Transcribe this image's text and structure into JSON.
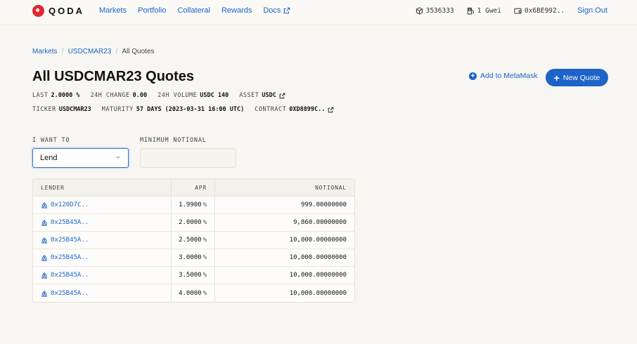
{
  "brand": {
    "name": "QODA"
  },
  "nav": {
    "links": [
      "Markets",
      "Portfolio",
      "Collateral",
      "Rewards",
      "Docs"
    ],
    "block": "3536333",
    "gas": "1 Gwei",
    "wallet": "0x6BE992..",
    "sign_out": "Sign Out"
  },
  "breadcrumb": [
    "Markets",
    "USDCMAR23",
    "All Quotes"
  ],
  "page": {
    "title": "All USDCMAR23 Quotes",
    "add_metamask": "Add to MetaMask",
    "new_quote": "New Quote"
  },
  "stats": {
    "last_label": "LAST",
    "last_value": "2.0000 %",
    "change_label": "24H CHANGE",
    "change_value": "0.00",
    "volume_label": "24H VOLUME",
    "volume_value": "USDC 140",
    "asset_label": "ASSET",
    "asset_value": "USDC",
    "ticker_label": "TICKER",
    "ticker_value": "USDCMAR23",
    "maturity_label": "MATURITY",
    "maturity_value": "57 DAYS (2023-03-31 16:00 UTC)",
    "contract_label": "CONTRACT",
    "contract_value": "0XD8899C.."
  },
  "form": {
    "want_label": "I WANT TO",
    "want_value": "Lend",
    "notional_label": "MINIMUM NOTIONAL",
    "notional_value": ""
  },
  "table": {
    "headers": [
      "LENDER",
      "APR",
      "NOTIONAL"
    ],
    "apr_unit": "%",
    "rows": [
      {
        "lender": "0x120D7C..",
        "apr": "1.9900",
        "notional": "999.00000000"
      },
      {
        "lender": "0x25B45A..",
        "apr": "2.0000",
        "notional": "9,860.00000000"
      },
      {
        "lender": "0x25B45A..",
        "apr": "2.5000",
        "notional": "10,000.00000000"
      },
      {
        "lender": "0x25B45A..",
        "apr": "3.0000",
        "notional": "10,000.00000000"
      },
      {
        "lender": "0x25B45A..",
        "apr": "3.5000",
        "notional": "10,000.00000000"
      },
      {
        "lender": "0x25B45A..",
        "apr": "4.0000",
        "notional": "10,000.00000000"
      }
    ]
  },
  "colors": {
    "accent": "#1d63c8",
    "brand": "#e0282e",
    "background": "#f8f6f2"
  }
}
